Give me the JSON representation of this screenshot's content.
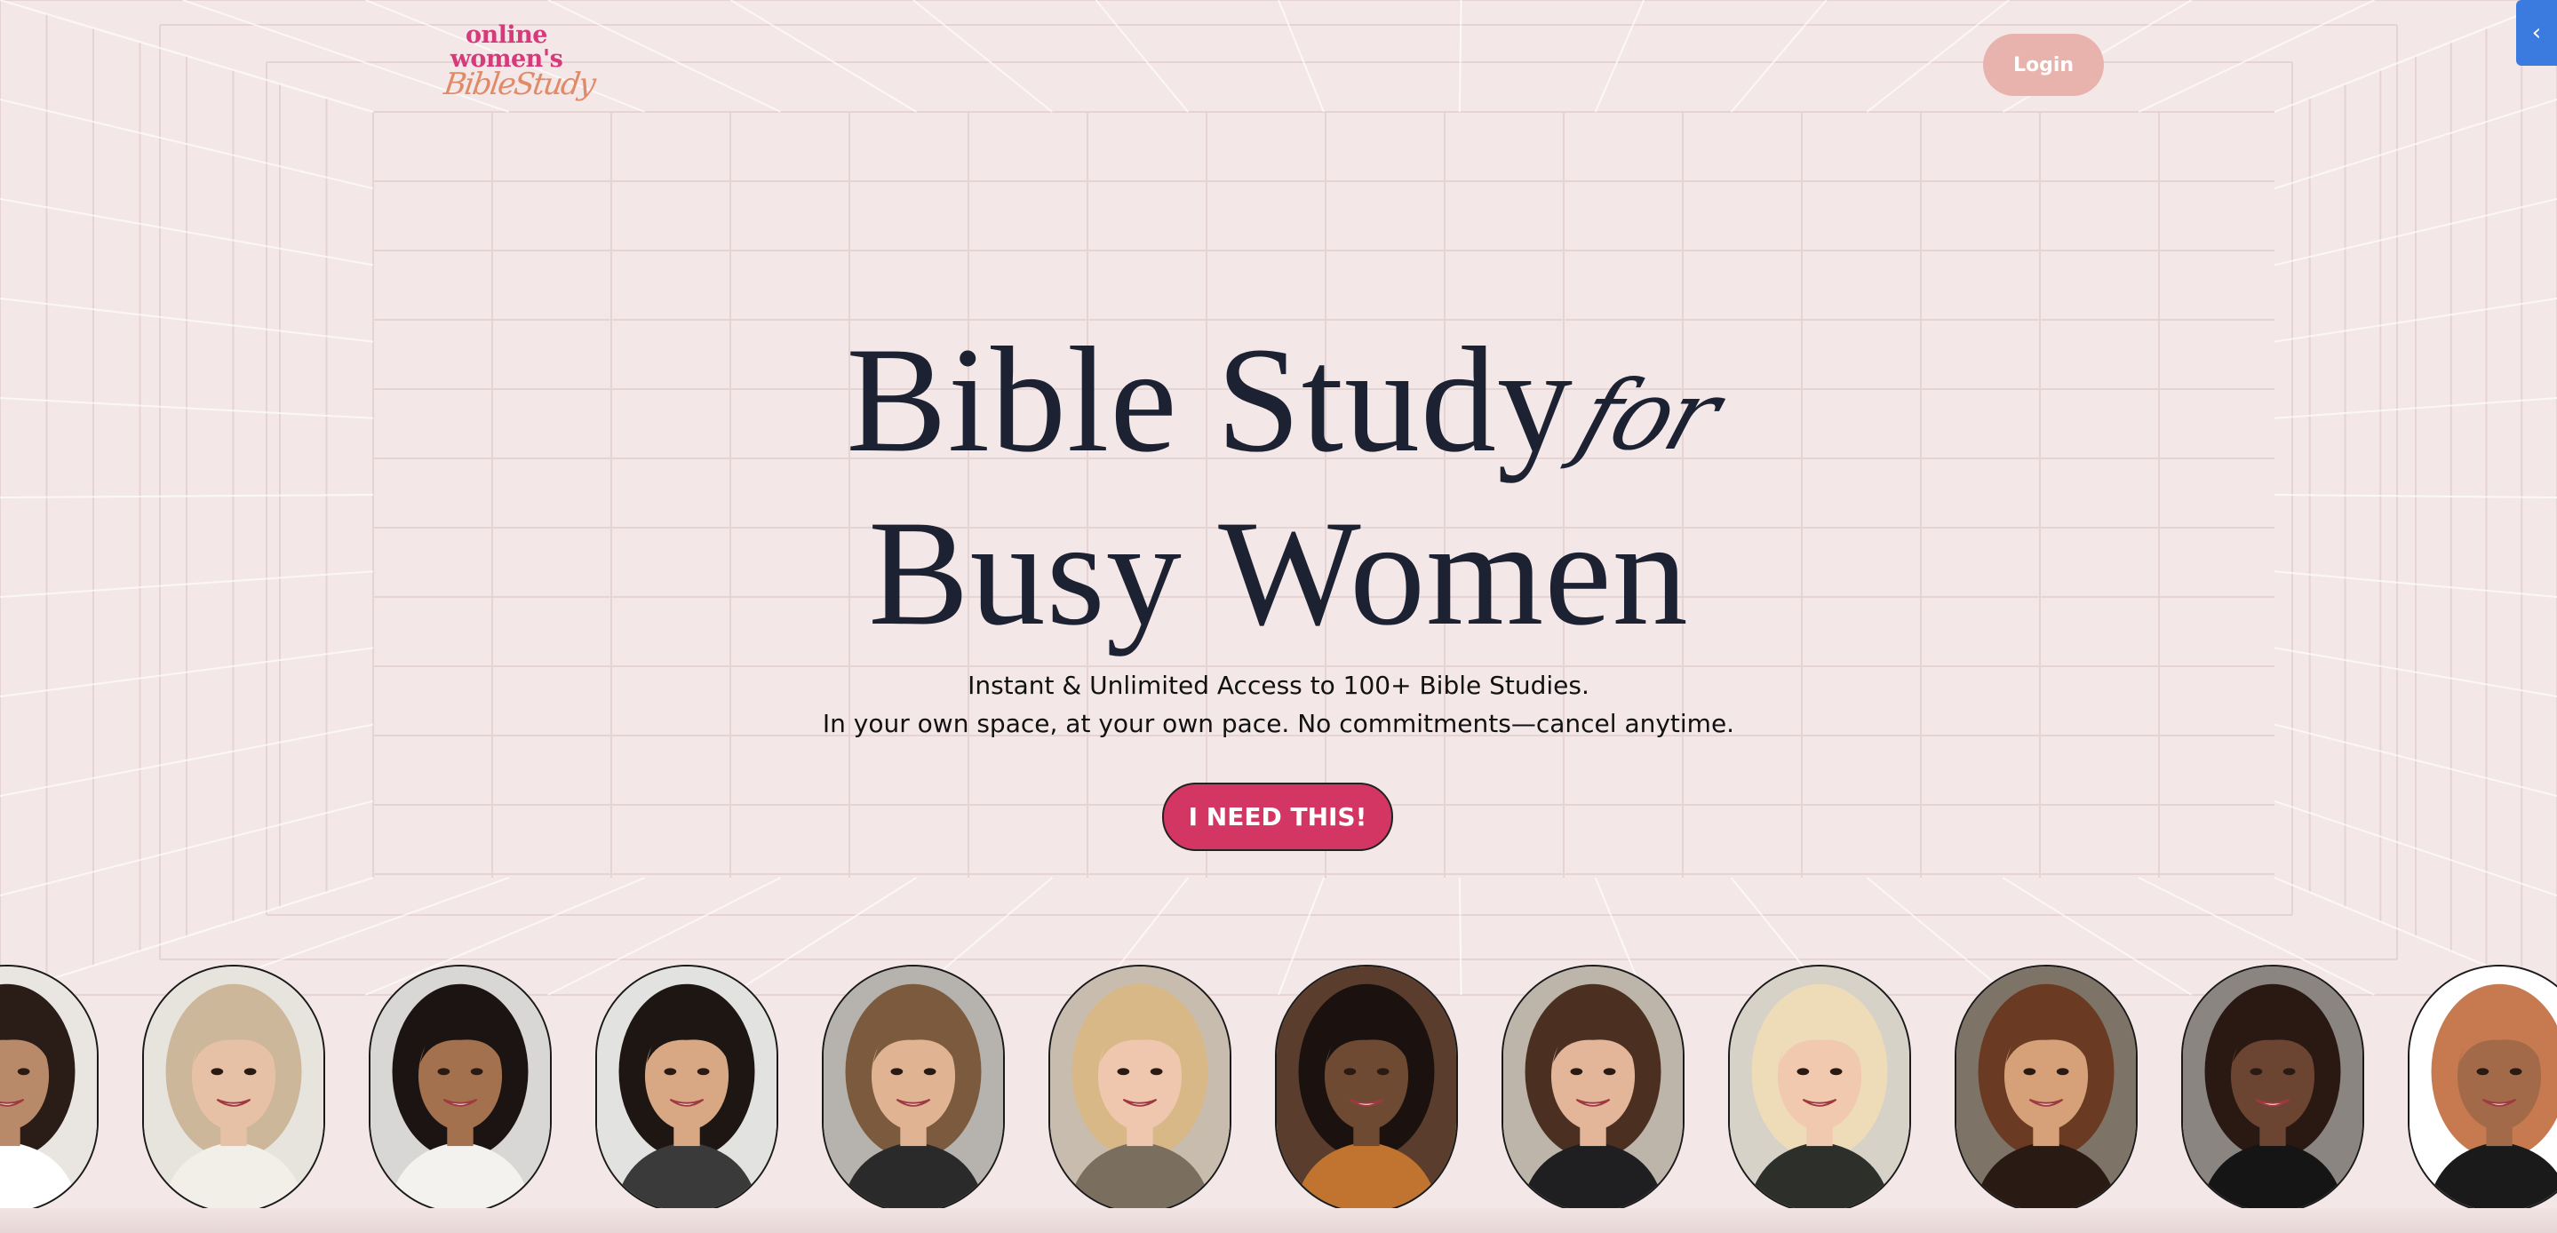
{
  "header": {
    "logo": {
      "line1": "online",
      "line2": "women's",
      "line3": "BibleStudy"
    },
    "login_label": "Login"
  },
  "side_tab": {
    "icon": "chevron-left-icon",
    "glyph": "‹"
  },
  "hero": {
    "title_line1": "Bible Study",
    "title_script": "for",
    "title_line2": "Busy Women",
    "subtitle_line1": "Instant & Unlimited Access to 100+ Bible Studies.",
    "subtitle_line2": "In your own space, at your own pace. No commitments—cancel anytime.",
    "cta_label": "I NEED THIS!"
  },
  "colors": {
    "background": "#f4e7e7",
    "title": "#1c2232",
    "cta": "#d33663",
    "login": "#e8b2ad",
    "logo_pink": "#d63a7a",
    "logo_orange": "#e08a68",
    "side_tab": "#3b7be0"
  },
  "carousel": {
    "portraits": [
      {
        "name": "portrait-1",
        "bg": "#e9e6e2",
        "hair": "#2a1d17",
        "skin": "#b98a6a",
        "shirt": "#ffffff"
      },
      {
        "name": "portrait-2",
        "bg": "#e7e3dd",
        "hair": "#cdb79a",
        "skin": "#e7c1a6",
        "shirt": "#f2efe9"
      },
      {
        "name": "portrait-3",
        "bg": "#d8d7d5",
        "hair": "#1b1412",
        "skin": "#a4714f",
        "shirt": "#f4f2ef"
      },
      {
        "name": "portrait-4",
        "bg": "#e2e3e1",
        "hair": "#1e1612",
        "skin": "#d8a783",
        "shirt": "#3a3a3a"
      },
      {
        "name": "portrait-5",
        "bg": "#b6b2ad",
        "hair": "#7b5a3e",
        "skin": "#e0b393",
        "shirt": "#2a2a2a"
      },
      {
        "name": "portrait-6",
        "bg": "#c8bcae",
        "hair": "#d9b887",
        "skin": "#efc7ae",
        "shirt": "#7a6f5e"
      },
      {
        "name": "portrait-7",
        "bg": "#5a3d2c",
        "hair": "#1b1210",
        "skin": "#6e4a33",
        "shirt": "#c0742f"
      },
      {
        "name": "portrait-8",
        "bg": "#bdb5aa",
        "hair": "#4b3022",
        "skin": "#e3b69a",
        "shirt": "#1f1f22"
      },
      {
        "name": "portrait-9",
        "bg": "#d6d2c8",
        "hair": "#eedcb8",
        "skin": "#f0c9ae",
        "shirt": "#2c2f2a"
      },
      {
        "name": "portrait-10",
        "bg": "#7d7467",
        "hair": "#6a3a22",
        "skin": "#d6a078",
        "shirt": "#2a1a14"
      },
      {
        "name": "portrait-11",
        "bg": "#8a8580",
        "hair": "#2a1812",
        "skin": "#6b4432",
        "shirt": "#151515"
      },
      {
        "name": "portrait-12",
        "bg": "#ffffff",
        "hair": "#c77a4f",
        "skin": "#a36a4a",
        "shirt": "#1a1a1a"
      }
    ]
  }
}
